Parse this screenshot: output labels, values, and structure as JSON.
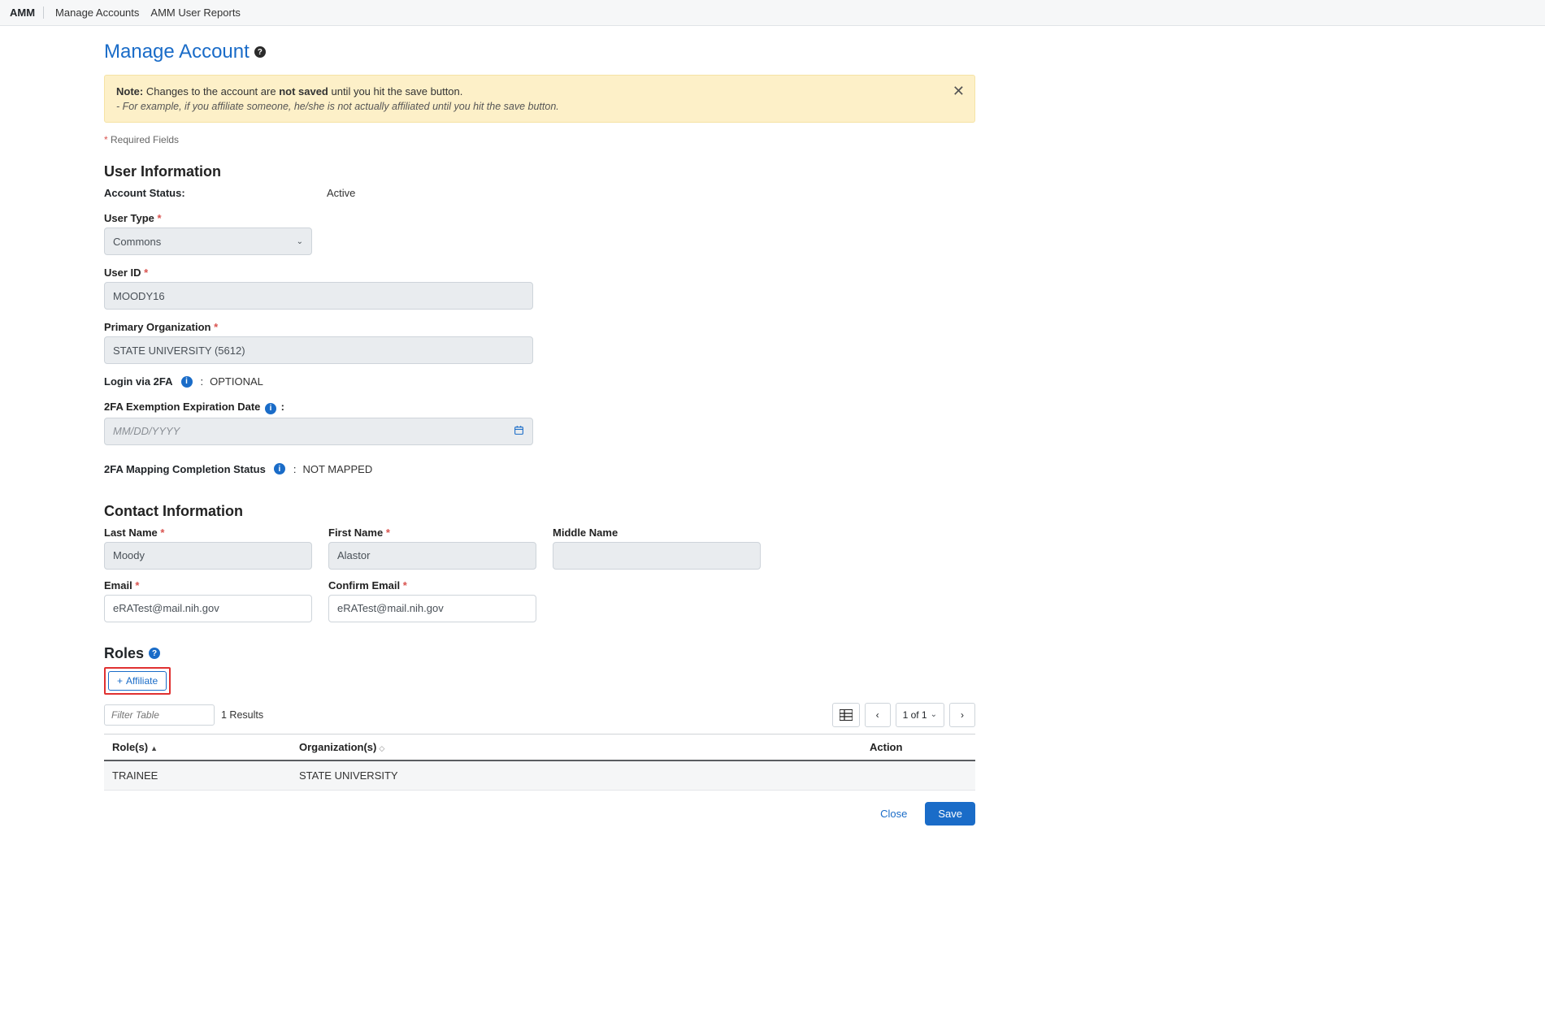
{
  "nav": {
    "brand": "AMM",
    "items": [
      "Manage Accounts",
      "AMM User Reports"
    ]
  },
  "page": {
    "title": "Manage Account",
    "note_label": "Note:",
    "note_text_pre": "Changes to the account are ",
    "note_text_bold": "not saved",
    "note_text_post": " until you hit the save button.",
    "note_sub": "- For example, if you affiliate someone, he/she is not actually affiliated until you hit the save button.",
    "required_legend": "Required Fields"
  },
  "user_info": {
    "heading": "User Information",
    "account_status_label": "Account Status:",
    "account_status_value": "Active",
    "user_type_label": "User Type",
    "user_type_value": "Commons",
    "user_id_label": "User ID",
    "user_id_value": "MOODY16",
    "primary_org_label": "Primary Organization",
    "primary_org_value": "STATE UNIVERSITY (5612)",
    "login_2fa_label": "Login via 2FA",
    "login_2fa_value": "OPTIONAL",
    "exemption_label": "2FA Exemption Expiration Date",
    "exemption_placeholder": "MM/DD/YYYY",
    "mapping_label": "2FA Mapping Completion Status",
    "mapping_value": "NOT MAPPED"
  },
  "contact": {
    "heading": "Contact Information",
    "last_name_label": "Last Name",
    "last_name_value": "Moody",
    "first_name_label": "First Name",
    "first_name_value": "Alastor",
    "middle_name_label": "Middle Name",
    "middle_name_value": "",
    "email_label": "Email",
    "email_value": "eRATest@mail.nih.gov",
    "confirm_email_label": "Confirm Email",
    "confirm_email_value": "eRATest@mail.nih.gov"
  },
  "roles": {
    "heading": "Roles",
    "affiliate_label": "Affiliate",
    "filter_placeholder": "Filter Table",
    "results_text": "1 Results",
    "pager_label": "1 of 1",
    "columns": {
      "role": "Role(s)",
      "org": "Organization(s)",
      "action": "Action"
    },
    "rows": [
      {
        "role": "TRAINEE",
        "org": "STATE UNIVERSITY",
        "action": ""
      }
    ]
  },
  "footer": {
    "close": "Close",
    "save": "Save"
  }
}
